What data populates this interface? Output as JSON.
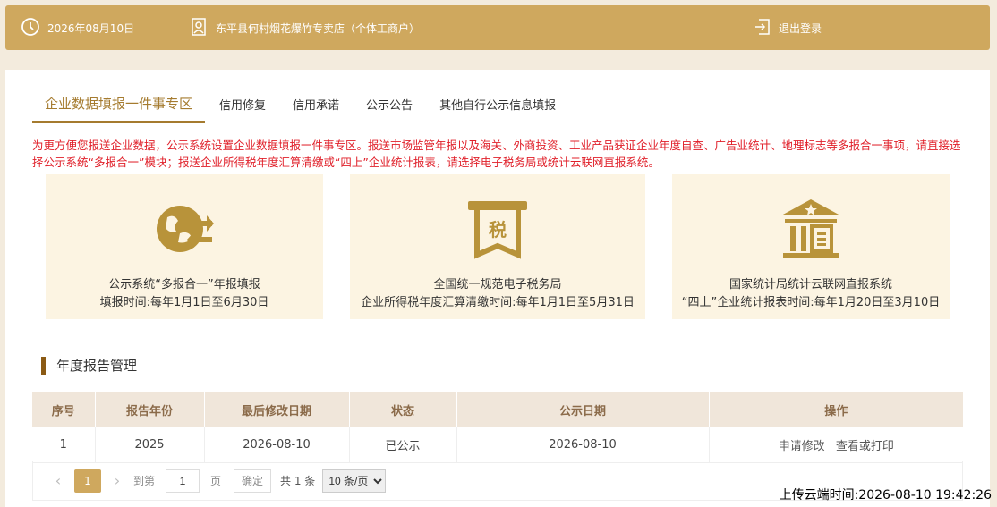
{
  "topbar": {
    "date": "2026年08月10日",
    "shop": "东平县何村烟花爆竹专卖店（个体工商户）",
    "logout": "退出登录"
  },
  "tabs": [
    {
      "label": "企业数据填报一件事专区",
      "active": true
    },
    {
      "label": "信用修复"
    },
    {
      "label": "信用承诺"
    },
    {
      "label": "公示公告"
    },
    {
      "label": "其他自行公示信息填报"
    }
  ],
  "notice": "为更方便您报送企业数据，公示系统设置企业数据填报一件事专区。报送市场监管年报以及海关、外商投资、工业产品获证企业年度自查、广告业统计、地理标志等多报合一事项，请直接选择公示系统“多报合一”模块；报送企业所得税年度汇算清缴或“四上”企业统计报表，请选择电子税务局或统计云联网直报系统。",
  "tiles": [
    {
      "title": "公示系统“多报合一”年报填报",
      "sub": "填报时间:每年1月1日至6月30日",
      "icon": "report-exchange-icon"
    },
    {
      "title": "全国统一规范电子税务局",
      "sub": "企业所得税年度汇算清缴时间:每年1月1日至5月31日",
      "icon": "tax-icon",
      "icon_text": "税"
    },
    {
      "title": "国家统计局统计云联网直报系统",
      "sub": "“四上”企业统计报表时间:每年1月20日至3月10日",
      "icon": "statistics-building-icon"
    }
  ],
  "section_title": "年度报告管理",
  "table": {
    "headers": [
      "序号",
      "报告年份",
      "最后修改日期",
      "状态",
      "公示日期",
      "操作"
    ],
    "rows": [
      {
        "no": "1",
        "year": "2025",
        "modified": "2026-08-10",
        "status": "已公示",
        "publish": "2026-08-10",
        "op1": "申请修改",
        "op2": "查看或打印"
      }
    ]
  },
  "pager": {
    "current": "1",
    "goto_label": "到第",
    "goto_value": "1",
    "page_label": "页",
    "confirm": "确定",
    "total": "共 1 条",
    "size": "10 条/页"
  },
  "upload_time": "上传云端时间:2026-08-10 19:42:26",
  "colors": {
    "accent": "#cfa85e",
    "brown": "#a57b2f",
    "notice": "#e0202a",
    "tile_bg": "#fcf4e2"
  }
}
